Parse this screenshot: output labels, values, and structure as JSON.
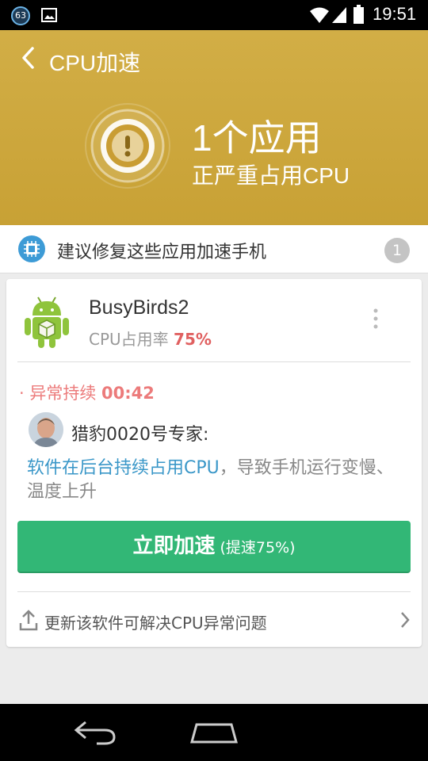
{
  "status_bar": {
    "notification_badge": "63",
    "time": "19:51",
    "icons": [
      "image-icon",
      "wifi-icon",
      "signal-icon",
      "battery-icon"
    ]
  },
  "header": {
    "back_icon": "back-chevron-icon",
    "title": "CPU加速",
    "count_text": "1个应用",
    "subtitle": "正严重占用CPU",
    "bg_color": "#caa33a"
  },
  "suggestion": {
    "text": "建议修复这些应用加速手机",
    "count": "1"
  },
  "app": {
    "name": "BusyBirds2",
    "usage_label": "CPU占用率",
    "usage_value": "75%",
    "abnormal_label": "· 异常持续",
    "abnormal_time": "00:42",
    "expert": "猎豹0020号专家:",
    "desc_link": "软件在后台持续占用CPU",
    "desc_rest": "，导致手机运行变慢、温度上升",
    "button_main": "立即加速",
    "button_sub": " (提速75%)",
    "update_text": "更新该软件可解决CPU异常问题"
  },
  "colors": {
    "accent_green": "#32b776",
    "warning_red": "#e06060",
    "link_blue": "#3a97c8"
  }
}
